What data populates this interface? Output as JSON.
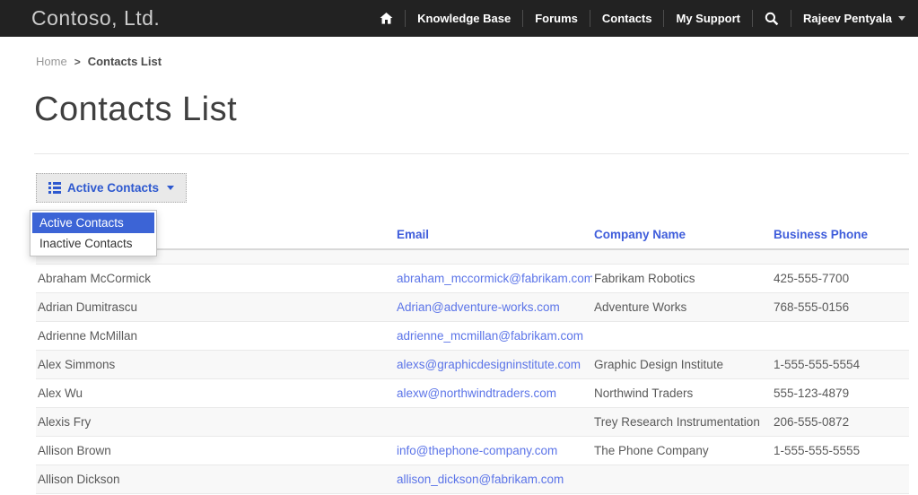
{
  "brand": "Contoso, Ltd.",
  "nav": {
    "items": [
      "Knowledge Base",
      "Forums",
      "Contacts",
      "My Support"
    ],
    "user": "Rajeev Pentyala"
  },
  "breadcrumb": {
    "home": "Home",
    "separator": ">",
    "current": "Contacts List"
  },
  "page": {
    "title": "Contacts List"
  },
  "toolbar": {
    "view_button_label": "Active Contacts"
  },
  "dropdown": {
    "items": [
      {
        "label": "Active Contacts",
        "selected": true
      },
      {
        "label": "Inactive Contacts",
        "selected": false
      }
    ]
  },
  "table": {
    "headers": {
      "name": "",
      "email": "Email",
      "company": "Company Name",
      "phone": "Business Phone"
    },
    "rows": [
      {
        "name": "Abraham McCormick",
        "email": "abraham_mccormick@fabrikam.com",
        "company": "Fabrikam Robotics",
        "phone": "425-555-7700"
      },
      {
        "name": "Adrian Dumitrascu",
        "email": "Adrian@adventure-works.com",
        "company": "Adventure Works",
        "phone": "768-555-0156"
      },
      {
        "name": "Adrienne McMillan",
        "email": "adrienne_mcmillan@fabrikam.com",
        "company": "",
        "phone": ""
      },
      {
        "name": "Alex Simmons",
        "email": "alexs@graphicdesigninstitute.com",
        "company": "Graphic Design Institute",
        "phone": "1-555-555-5554"
      },
      {
        "name": "Alex Wu",
        "email": "alexw@northwindtraders.com",
        "company": "Northwind Traders",
        "phone": "555-123-4879"
      },
      {
        "name": "Alexis Fry",
        "email": "",
        "company": "Trey Research Instrumentation",
        "phone": "206-555-0872"
      },
      {
        "name": "Allison Brown",
        "email": "info@thephone-company.com",
        "company": "The Phone Company",
        "phone": "1-555-555-5555"
      },
      {
        "name": "Allison Dickson",
        "email": "allison_dickson@fabrikam.com",
        "company": "",
        "phone": ""
      }
    ]
  },
  "colors": {
    "navbar_bg": "#222222",
    "accent_header_blue": "#3f5ddb",
    "link_blue": "#5b74e8",
    "dropdown_selected_bg": "#3c64d6",
    "button_text_blue": "#2d58cf",
    "stripe_gray": "#f8f8f8"
  }
}
